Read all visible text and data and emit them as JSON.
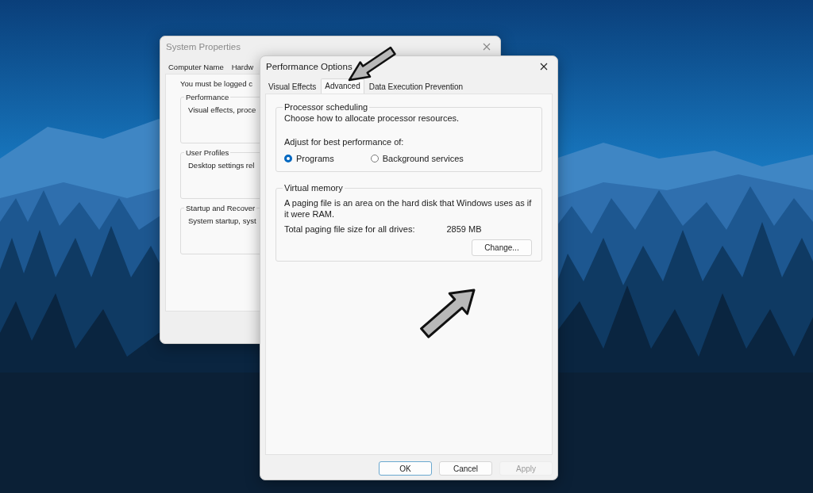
{
  "system_properties": {
    "title": "System Properties",
    "tabs": [
      {
        "label": "Computer Name",
        "selected": false
      },
      {
        "label": "Hardw",
        "selected": false
      }
    ],
    "notice": "You must be logged c",
    "groups": [
      {
        "title": "Performance",
        "text": "Visual effects, proce"
      },
      {
        "title": "User Profiles",
        "text": "Desktop settings rel"
      },
      {
        "title": "Startup and Recover",
        "text": "System startup, syst"
      }
    ]
  },
  "performance_options": {
    "title": "Performance Options",
    "tabs": [
      {
        "label": "Visual Effects",
        "selected": false
      },
      {
        "label": "Advanced",
        "selected": true
      },
      {
        "label": "Data Execution Prevention",
        "selected": false
      }
    ],
    "processor_scheduling": {
      "title": "Processor scheduling",
      "description": "Choose how to allocate processor resources.",
      "prompt": "Adjust for best performance of:",
      "options": [
        {
          "label": "Programs",
          "selected": true
        },
        {
          "label": "Background services",
          "selected": false
        }
      ]
    },
    "virtual_memory": {
      "title": "Virtual memory",
      "description": "A paging file is an area on the hard disk that Windows uses as if it were RAM.",
      "total_label": "Total paging file size for all drives:",
      "total_value": "2859 MB",
      "button": "Change..."
    },
    "buttons": [
      {
        "label": "OK",
        "is_default": true,
        "disabled": false
      },
      {
        "label": "Cancel",
        "is_default": false,
        "disabled": false
      },
      {
        "label": "Apply",
        "is_default": false,
        "disabled": true
      }
    ]
  }
}
